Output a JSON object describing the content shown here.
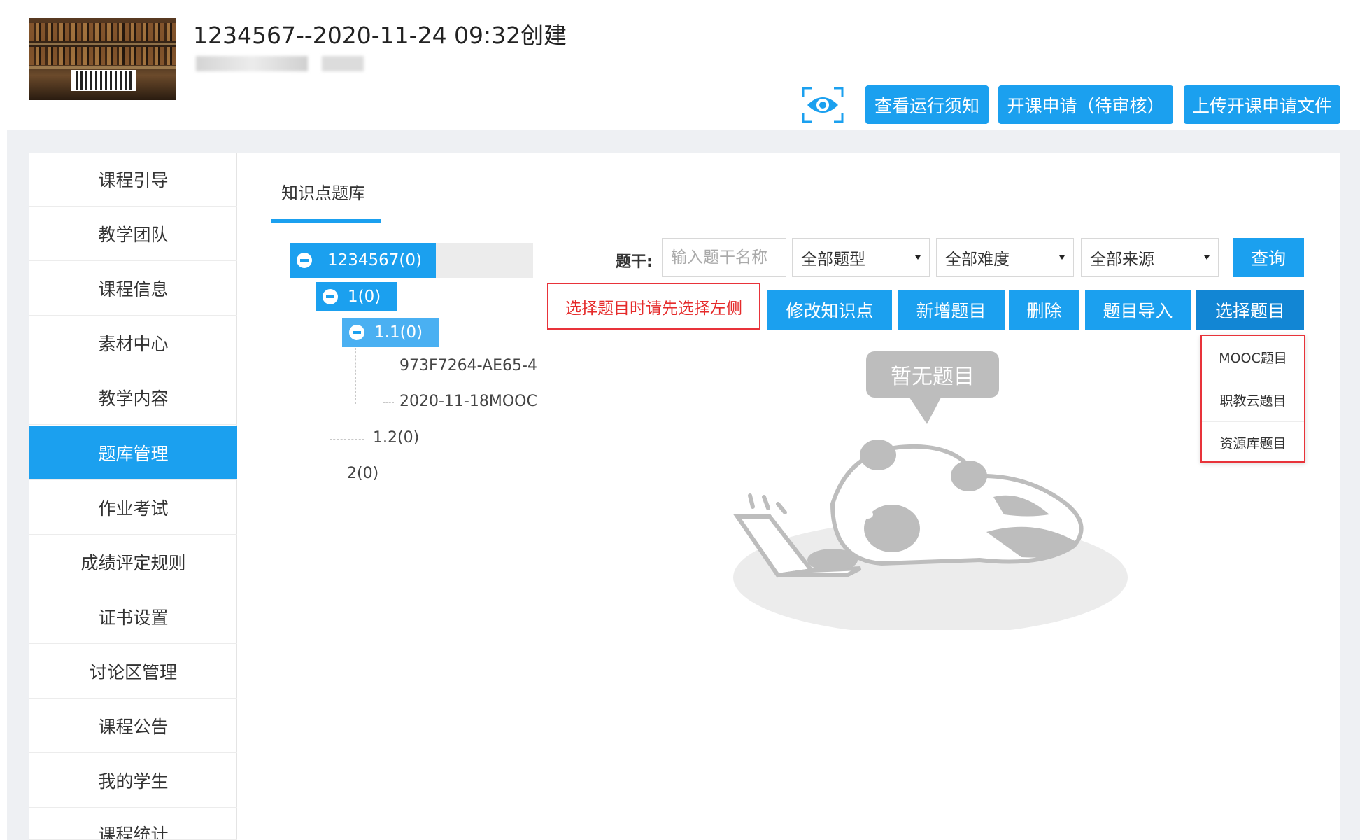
{
  "header": {
    "course_title": "1234567--2020-11-24 09:32创建",
    "buttons": {
      "view_notice": "查看运行须知",
      "apply_course": "开课申请（待审核）",
      "upload_file": "上传开课申请文件"
    }
  },
  "sidebar": {
    "items": [
      {
        "label": "课程引导"
      },
      {
        "label": "教学团队"
      },
      {
        "label": "课程信息"
      },
      {
        "label": "素材中心"
      },
      {
        "label": "教学内容"
      },
      {
        "label": "题库管理"
      },
      {
        "label": "作业考试"
      },
      {
        "label": "成绩评定规则"
      },
      {
        "label": "证书设置"
      },
      {
        "label": "讨论区管理"
      },
      {
        "label": "课程公告"
      },
      {
        "label": "我的学生"
      },
      {
        "label": "课程统计"
      }
    ],
    "active_index": 5
  },
  "tabs": [
    {
      "label": "知识点题库"
    }
  ],
  "tree": {
    "root": "1234567(0)",
    "n1": "1(0)",
    "n11": "1.1(0)",
    "leaf1": "973F7264-AE65-4",
    "leaf2": "2020-11-18MOOC",
    "n12": "1.2(0)",
    "n2": "2(0)"
  },
  "filters": {
    "stem_label": "题干:",
    "stem_placeholder": "输入题干名称",
    "type": "全部题型",
    "difficulty": "全部难度",
    "source": "全部来源",
    "query": "查询"
  },
  "actions": {
    "hint": "选择题目时请先选择左侧",
    "edit_point": "修改知识点",
    "add_question": "新增题目",
    "delete": "删除",
    "import": "题目导入",
    "select": "选择题目"
  },
  "select_menu": [
    {
      "label": "MOOC题目"
    },
    {
      "label": "职教云题目"
    },
    {
      "label": "资源库题目"
    }
  ],
  "empty": {
    "text": "暂无题目"
  },
  "colors": {
    "primary": "#1ba0ef",
    "alert": "#e8333a"
  }
}
